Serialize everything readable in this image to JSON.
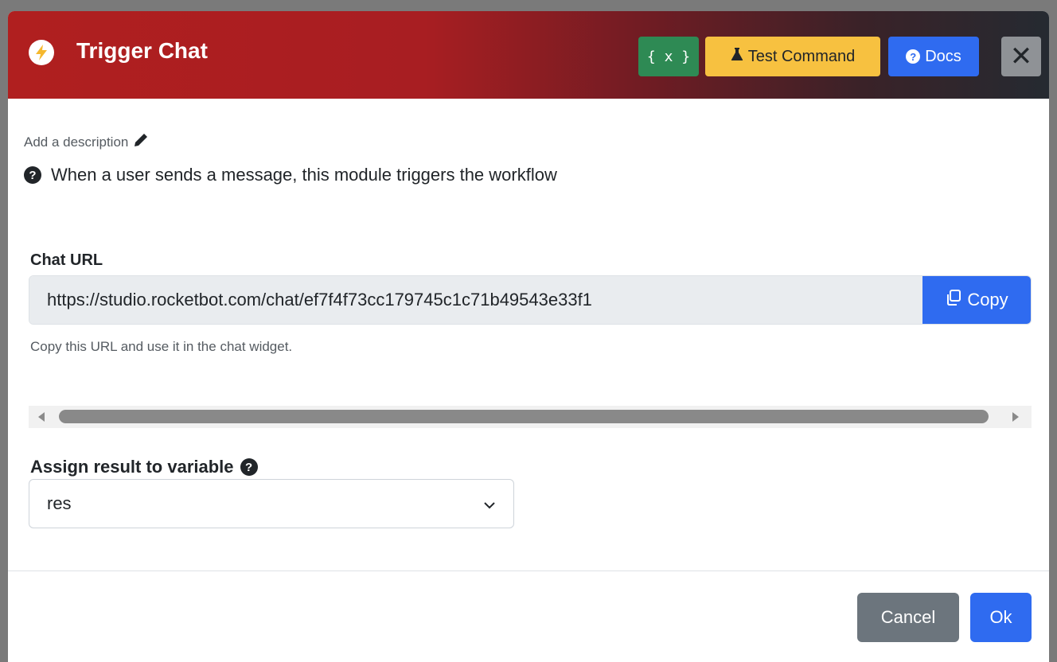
{
  "modal": {
    "title": "Trigger Chat",
    "header_buttons": {
      "variables": "{ x }",
      "test_command": "Test Command",
      "docs": "Docs",
      "close": "✕"
    },
    "description_link": "Add a description",
    "help_text": "When a user sends a message, this module triggers the workflow",
    "chat_url": {
      "label": "Chat URL",
      "value": "https://studio.rocketbot.com/chat/ef7f4f73cc179745c1c71b49543e33f1",
      "copy_label": "Copy",
      "help": "Copy this URL and use it in the chat widget."
    },
    "assign_variable": {
      "label": "Assign result to variable",
      "selected": "res"
    },
    "footer": {
      "cancel": "Cancel",
      "ok": "Ok"
    }
  },
  "icons": {
    "header": "bolt-icon",
    "test": "flask-icon",
    "docs": "question-circle-icon",
    "description": "pencil-icon",
    "help": "question-circle-icon",
    "copy": "copy-icon",
    "select": "chevron-down-icon"
  },
  "colors": {
    "header_start": "#b01f1f",
    "header_end": "#252a31",
    "variables_button": "#2e8a54",
    "test_button": "#f7c140",
    "primary": "#2f6bf0",
    "secondary": "#6c757d",
    "bolt": "#f5b82e"
  }
}
